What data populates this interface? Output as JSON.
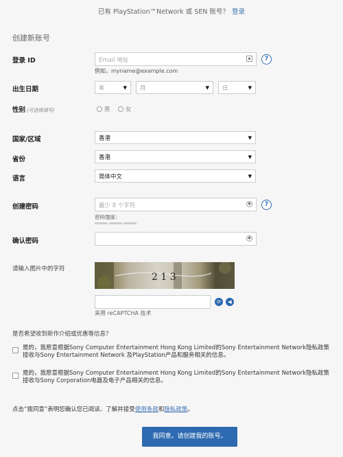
{
  "top": {
    "question": "已有 PlayStation™Network 或 SEN 账号？",
    "login_link": "登录"
  },
  "section_title": "创建新账号",
  "login_id": {
    "label": "登录 ID",
    "placeholder": "Email 地址",
    "hint": "例如，myname@example.com"
  },
  "birthdate": {
    "label": "出生日期",
    "year": "年",
    "month": "月",
    "day": "日"
  },
  "gender": {
    "label": "性别",
    "optional": "(可选择填写)",
    "male": "男",
    "female": "女"
  },
  "country": {
    "label": "国家/区域",
    "value": "香港"
  },
  "province": {
    "label": "省份",
    "value": "香港"
  },
  "language": {
    "label": "语言",
    "value": "简体中文"
  },
  "password": {
    "label": "创建密码",
    "placeholder": "最少 8 个字符",
    "strength_label": "密码强度："
  },
  "confirm_password": {
    "label": "确认密码"
  },
  "captcha": {
    "label": "请输入图片中的字符",
    "image_text": "2 1 3",
    "powered_by": "采用 reCAPTCHA 技术"
  },
  "newsletter": {
    "question": "是否希望收到新作介绍或优惠等信息？",
    "option1": "是的，我愿意根据Sony Computer Entertainment Hong Kong Limited的Sony Entertainment Network隐私政策接收与Sony Entertainment Network 及PlayStation产品和服务相关的信息。",
    "option2": "是的，我愿意根据Sony Computer Entertainment Hong Kong Limited的Sony Entertainment Network隐私政策接收与Sony Corporation电器及电子产品相关的信息。"
  },
  "footer": {
    "prefix": "点击“我同意”表明您确认您已阅读、了解并接受",
    "terms_link": "使用条款",
    "and": "和",
    "privacy_link": "隐私政策",
    "suffix": "。"
  },
  "submit_label": "我同意。请创建我的账号。",
  "icons": {
    "help": "?",
    "refresh": "⟳",
    "audio": "◀",
    "dropdown": "▼"
  }
}
